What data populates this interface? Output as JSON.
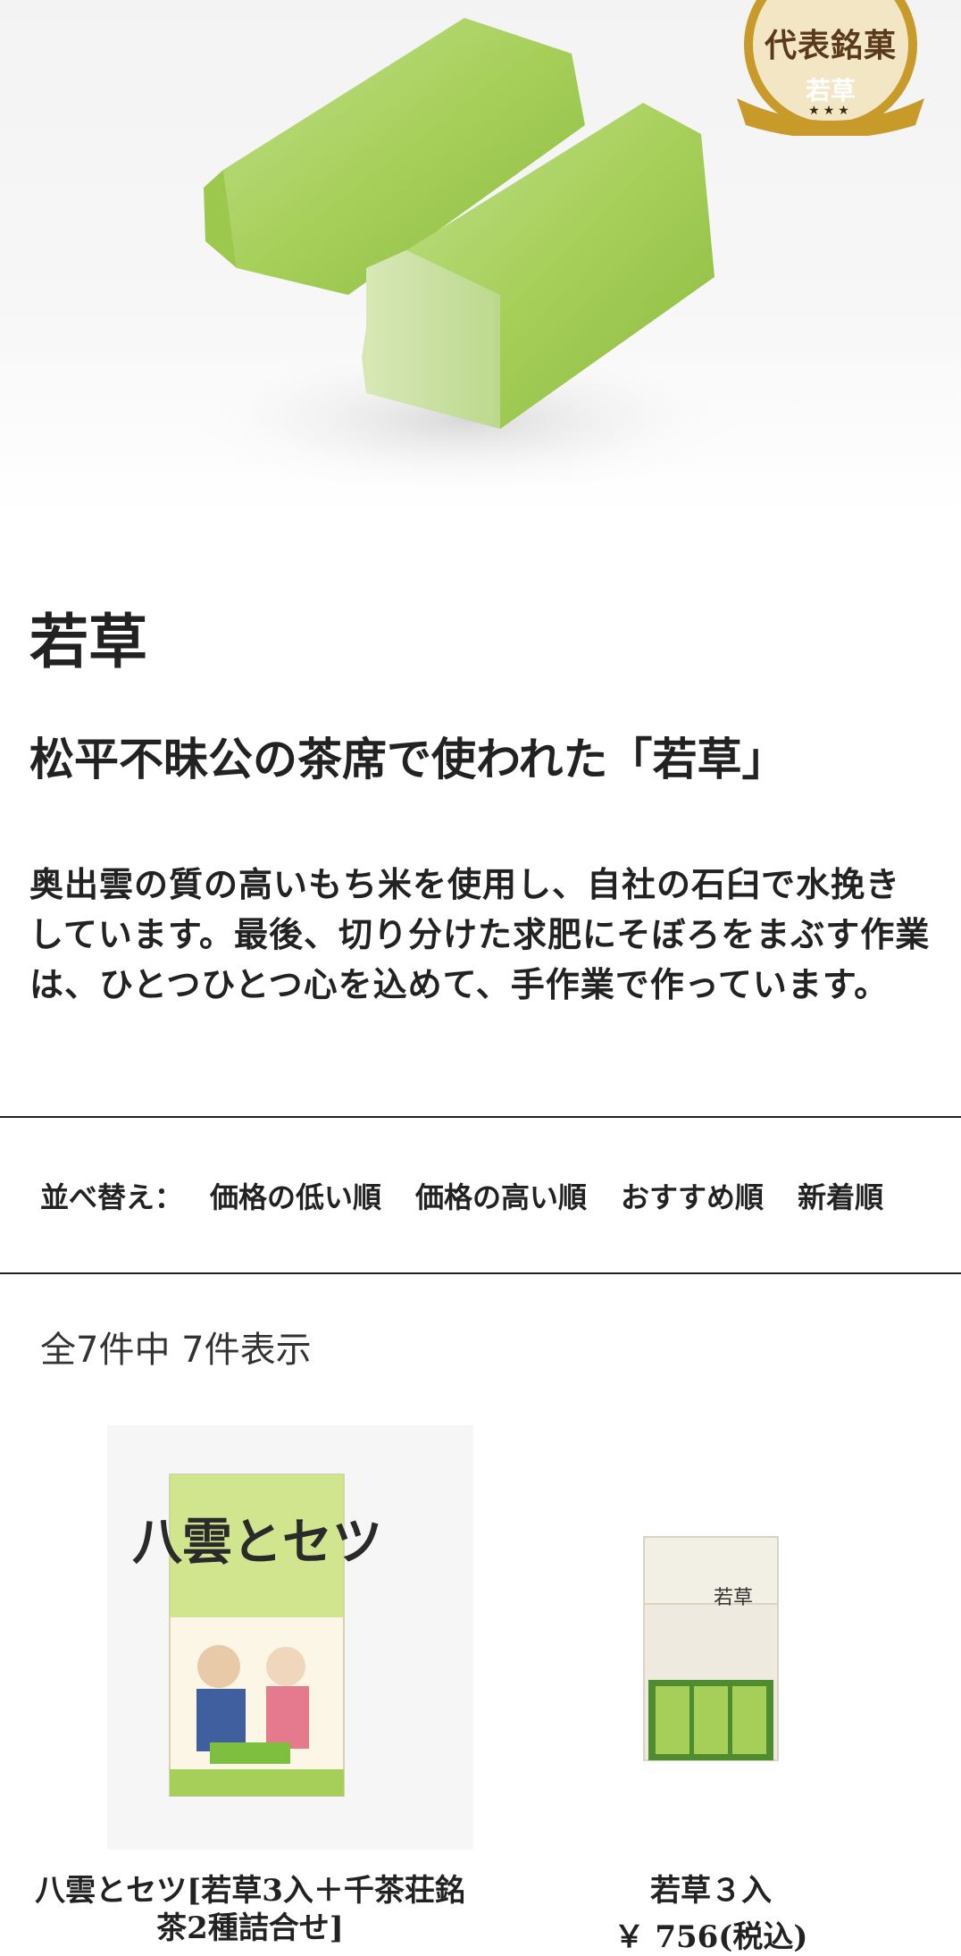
{
  "hero": {
    "badge_title": "代表銘菓",
    "badge_subtitle": "若草",
    "badge_stars": "★★★"
  },
  "product": {
    "title": "若草",
    "subtitle": "松平不昧公の茶席で使われた「若草」",
    "description": "奥出雲の質の高いもち米を使用し、自社の石臼で水挽きしています。最後、切り分けた求肥にそぼろをまぶす作業は、ひとつひとつ心を込めて、手作業で作っています。"
  },
  "sort": {
    "label": "並べ替え：",
    "options": [
      "価格の低い順",
      "価格の高い順",
      "おすすめ順",
      "新着順"
    ]
  },
  "results": {
    "count_text": "全7件中 7件表示"
  },
  "items": [
    {
      "name": "八雲とセツ[若草3入＋千茶荘銘茶2種詰合せ]",
      "price": "",
      "package_text": "八雲とセツ"
    },
    {
      "name": "若草３入",
      "price": "￥ 756(税込)",
      "package_text": "若草"
    }
  ],
  "colors": {
    "accent_green": "#a6cf5a",
    "badge_gold": "#c89a2a",
    "text": "#222222"
  }
}
